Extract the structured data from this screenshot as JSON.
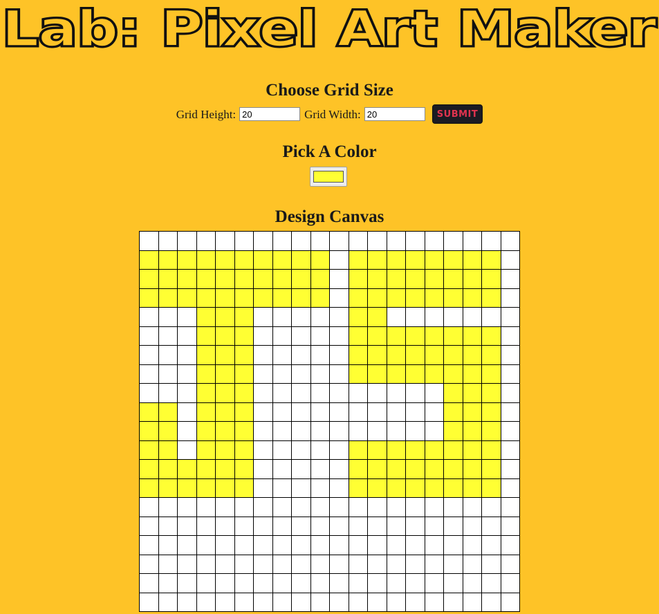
{
  "app": {
    "title": "Lab: Pixel Art Maker"
  },
  "grid_section": {
    "heading": "Choose Grid Size",
    "height_label": "Grid Height:",
    "height_value": "20",
    "width_label": "Grid Width:",
    "width_value": "20",
    "submit_label": "SUBMIT"
  },
  "color_section": {
    "heading": "Pick A Color",
    "selected_color": "#FFFF33"
  },
  "canvas_section": {
    "heading": "Design Canvas",
    "rows": 20,
    "cols": 20,
    "painted_rows": [
      "....................",
      "XXXXXXXXXX.XXXXXXXX.",
      "XXXXXXXXXX.XXXXXXXX.",
      "XXXXXXXXXX.XXXXXXXX.",
      "...XXX.....XX.......",
      "...XXX.....XXXXXXXX.",
      "...XXX.....XXXXXXXX.",
      "...XXX.....XXXXXXXX.",
      "...XXX..........XXX.",
      "XX.XXX..........XXX.",
      "XX.XXX..........XXX.",
      "XX.XXX.....XXXXXXXX.",
      "XXXXXX.....XXXXXXXX.",
      "XXXXXX.....XXXXXXXX.",
      "....................",
      "....................",
      "....................",
      "....................",
      "....................",
      "...................."
    ]
  },
  "colors": {
    "background": "#FEC327",
    "paint": "#FFFF33",
    "empty_cell": "#FFFFFF"
  }
}
